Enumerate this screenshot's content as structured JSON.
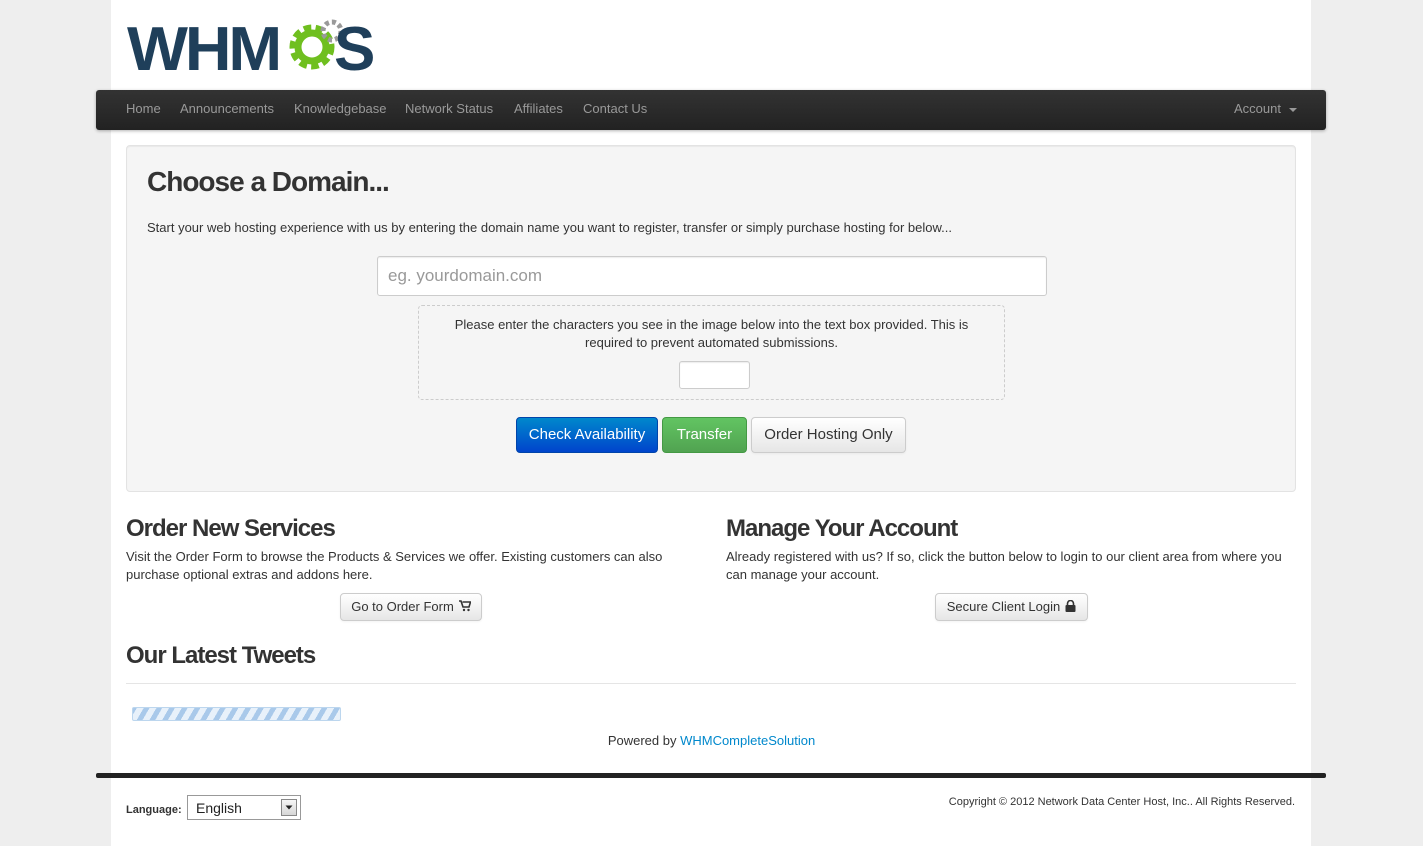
{
  "brand": {
    "logo_text": "WHMCS"
  },
  "nav": {
    "items": [
      "Home",
      "Announcements",
      "Knowledgebase",
      "Network Status",
      "Affiliates",
      "Contact Us"
    ],
    "account_label": "Account"
  },
  "domain": {
    "title": "Choose a Domain...",
    "intro": "Start your web hosting experience with us by entering the domain name you want to register, transfer or simply purchase hosting for below...",
    "placeholder": "eg. yourdomain.com",
    "captcha_text": "Please enter the characters you see in the image below into the text box provided. This is required to prevent automated submissions.",
    "check_label": "Check Availability",
    "transfer_label": "Transfer",
    "hosting_only_label": "Order Hosting Only"
  },
  "order": {
    "title": "Order New Services",
    "text": "Visit the Order Form to browse the Products & Services we offer. Existing customers can also purchase optional extras and addons here.",
    "button_label": "Go to Order Form"
  },
  "account": {
    "title": "Manage Your Account",
    "text": "Already registered with us? If so, click the button below to login to our client area from where you can manage your account.",
    "button_label": "Secure Client Login"
  },
  "tweets": {
    "title": "Our Latest Tweets"
  },
  "powered": {
    "prefix": "Powered by ",
    "link": "WHMCompleteSolution"
  },
  "footer": {
    "language_label": "Language:",
    "language_value": "English",
    "copyright": "Copyright © 2012 Network Data Center Host, Inc.. All Rights Reserved."
  },
  "colors": {
    "logo_dark": "#1f3f5a",
    "logo_green": "#6fbf1f",
    "navbar": "#222222",
    "primary": "#0058cc",
    "success": "#51a351",
    "link": "#0088cc"
  }
}
